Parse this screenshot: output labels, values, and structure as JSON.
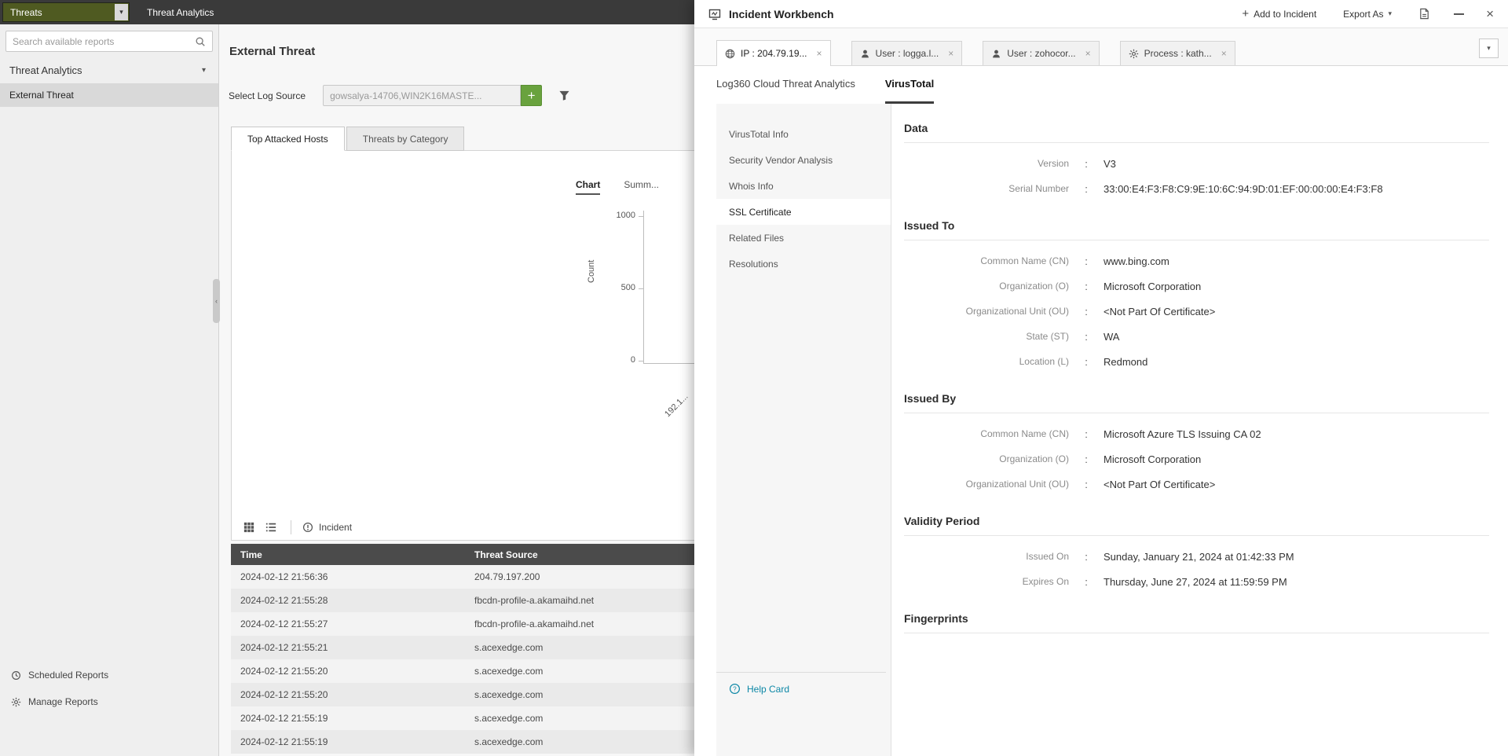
{
  "topbar": {
    "module_select": "Threats",
    "tab": "Threat Analytics"
  },
  "sidebar": {
    "search_placeholder": "Search available reports",
    "section": "Threat Analytics",
    "items": [
      {
        "label": "External Threat",
        "selected": true
      }
    ],
    "footer": [
      {
        "label": "Scheduled Reports",
        "icon": "clock-icon"
      },
      {
        "label": "Manage Reports",
        "icon": "gear-icon"
      }
    ]
  },
  "main": {
    "title": "External Threat",
    "log_source_label": "Select Log Source",
    "log_source_value": "gowsalya-14706,WIN2K16MASTE...",
    "tabs": [
      "Top Attacked Hosts",
      "Threats by Category"
    ],
    "chart": {
      "view_tabs": [
        "Chart",
        "Summ..."
      ],
      "ylabel": "Count",
      "yticks": [
        "1000",
        "500",
        "0"
      ],
      "xtick": "192.1..."
    },
    "toolbar": {
      "incident_label": "Incident"
    },
    "table": {
      "columns": [
        "Time",
        "Threat Source"
      ],
      "rows": [
        [
          "2024-02-12 21:56:36",
          "204.79.197.200"
        ],
        [
          "2024-02-12 21:55:28",
          "fbcdn-profile-a.akamaihd.net"
        ],
        [
          "2024-02-12 21:55:27",
          "fbcdn-profile-a.akamaihd.net"
        ],
        [
          "2024-02-12 21:55:21",
          "s.acexedge.com"
        ],
        [
          "2024-02-12 21:55:20",
          "s.acexedge.com"
        ],
        [
          "2024-02-12 21:55:20",
          "s.acexedge.com"
        ],
        [
          "2024-02-12 21:55:19",
          "s.acexedge.com"
        ],
        [
          "2024-02-12 21:55:19",
          "s.acexedge.com"
        ]
      ]
    }
  },
  "workbench": {
    "title": "Incident Workbench",
    "actions": {
      "add_to_incident": "Add to Incident",
      "export_as": "Export As"
    },
    "entity_tabs": [
      {
        "label": "IP : 204.79.19...",
        "icon": "globe-icon",
        "active": true
      },
      {
        "label": "User : logga.l...",
        "icon": "user-icon",
        "active": false
      },
      {
        "label": "User : zohocor...",
        "icon": "user-icon",
        "active": false
      },
      {
        "label": "Process : kath...",
        "icon": "gear-icon",
        "active": false
      }
    ],
    "source_tabs": [
      {
        "label": "Log360 Cloud Threat Analytics",
        "active": false
      },
      {
        "label": "VirusTotal",
        "active": true
      }
    ],
    "nav": [
      "VirusTotal Info",
      "Security Vendor Analysis",
      "Whois Info",
      "SSL Certificate",
      "Related Files",
      "Resolutions"
    ],
    "nav_selected": "SSL Certificate",
    "help_card": "Help Card",
    "content": {
      "sections": [
        {
          "heading": "Data",
          "rows": [
            [
              "Version",
              "V3"
            ],
            [
              "Serial Number",
              "33:00:E4:F3:F8:C9:9E:10:6C:94:9D:01:EF:00:00:00:E4:F3:F8"
            ]
          ]
        },
        {
          "heading": "Issued To",
          "rows": [
            [
              "Common Name (CN)",
              "www.bing.com"
            ],
            [
              "Organization (O)",
              "Microsoft Corporation"
            ],
            [
              "Organizational Unit (OU)",
              "<Not Part Of Certificate>"
            ],
            [
              "State (ST)",
              "WA"
            ],
            [
              "Location (L)",
              "Redmond"
            ]
          ]
        },
        {
          "heading": "Issued By",
          "rows": [
            [
              "Common Name (CN)",
              "Microsoft Azure TLS Issuing CA 02"
            ],
            [
              "Organization (O)",
              "Microsoft Corporation"
            ],
            [
              "Organizational Unit (OU)",
              "<Not Part Of Certificate>"
            ]
          ]
        },
        {
          "heading": "Validity Period",
          "rows": [
            [
              "Issued On",
              "Sunday, January 21, 2024 at 01:42:33 PM"
            ],
            [
              "Expires On",
              "Thursday, June 27, 2024 at 11:59:59 PM"
            ]
          ]
        },
        {
          "heading": "Fingerprints",
          "rows": []
        }
      ]
    }
  },
  "colors": {
    "accent_olive": "#4f5a21",
    "accent_green": "#69a23e",
    "help_link": "#0c87a6",
    "table_header": "#4b4b4b"
  }
}
